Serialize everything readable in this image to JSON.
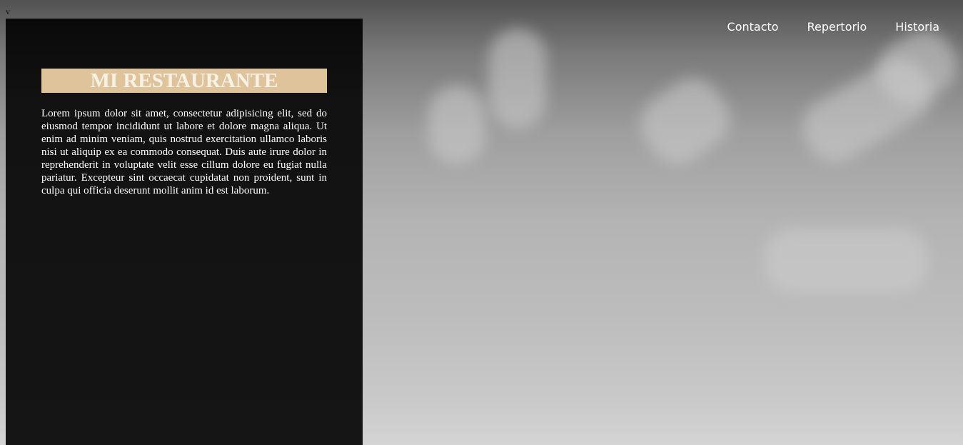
{
  "corner_mark": "v",
  "brand": {
    "title": "MI RESTAURANTE",
    "accent_color": "#dfc39b"
  },
  "intro": {
    "text": "Lorem ipsum dolor sit amet, consectetur adipisicing elit, sed do eiusmod tempor incididunt ut labore et dolore magna aliqua. Ut enim ad minim veniam, quis nostrud exercitation ullamco laboris nisi ut aliquip ex ea commodo consequat. Duis aute irure dolor in reprehenderit in voluptate velit esse cillum dolore eu fugiat nulla pariatur. Excepteur sint occaecat cupidatat non proident, sunt in culpa qui officia deserunt mollit anim id est laborum."
  },
  "nav": {
    "items": [
      {
        "label": "Contacto"
      },
      {
        "label": "Repertorio"
      },
      {
        "label": "Historia"
      }
    ]
  }
}
